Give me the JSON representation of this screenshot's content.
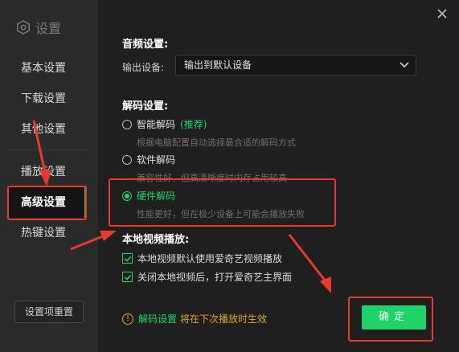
{
  "sidebar": {
    "brand": "设置",
    "items": [
      {
        "label": "基本设置"
      },
      {
        "label": "下载设置"
      },
      {
        "label": "其他设置"
      },
      {
        "label": "播放设置"
      },
      {
        "label": "高级设置"
      },
      {
        "label": "热键设置"
      }
    ],
    "reset_label": "设置项重置"
  },
  "audio": {
    "title": "音频设置:",
    "output_label": "输出设备:",
    "output_value": "输出到默认设备"
  },
  "decode": {
    "title": "解码设置:",
    "options": [
      {
        "label": "智能解码",
        "badge": "(推荐)",
        "desc": "根据电脑配置自动选择最合适的解码方式"
      },
      {
        "label": "软件解码",
        "desc": "兼容性好，但高清晰度时内存占用较高"
      },
      {
        "label": "硬件解码",
        "desc": "性能更好，但在极少设备上可能会播放失败"
      }
    ]
  },
  "local": {
    "title": "本地视频播放:",
    "checks": [
      {
        "label": "本地视频默认使用爱奇艺视频播放"
      },
      {
        "label": "关闭本地视频后，打开爱奇艺主界面"
      }
    ]
  },
  "tip": {
    "icon": "!",
    "key": "解码设置",
    "text": "将在下次播放时生效"
  },
  "ok_label": "确定",
  "colors": {
    "accent": "#1fd36b",
    "annotation": "#e53a2f",
    "warning": "#d8a52a"
  }
}
